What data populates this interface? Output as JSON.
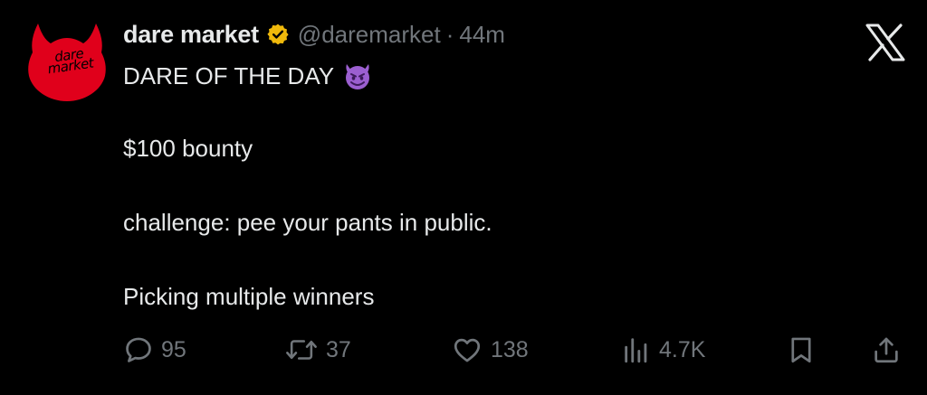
{
  "tweet": {
    "display_name": "dare market",
    "handle": "@daremarket",
    "separator": "·",
    "time": "44m",
    "avatar_text": "dare market",
    "lines": [
      "DARE OF THE DAY",
      "$100 bounty",
      "challenge: pee your pants in public.",
      "Picking multiple winners"
    ],
    "icons": {
      "verified": "verified-badge-icon",
      "emoji": "smiling-devil-emoji",
      "logo": "x-logo-icon"
    }
  },
  "actions": {
    "replies": "95",
    "reposts": "37",
    "likes": "138",
    "views": "4.7K"
  },
  "colors": {
    "background": "#000000",
    "text": "#e7e9ea",
    "muted": "#71767b",
    "avatar": "#e0001b",
    "verified_gold": "#f0b90b",
    "emoji_purple": "#9b5fd0"
  }
}
